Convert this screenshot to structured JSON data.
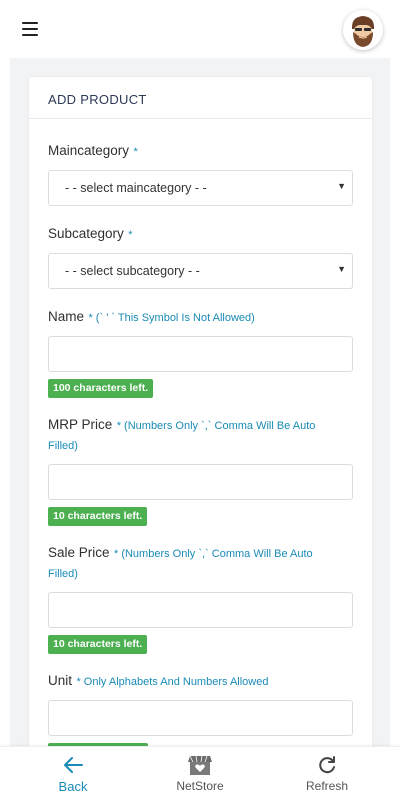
{
  "form": {
    "title": "ADD PRODUCT",
    "maincategory": {
      "label": "Maincategory",
      "required": "*",
      "selected": "- - select maincategory - -"
    },
    "subcategory": {
      "label": "Subcategory",
      "required": "*",
      "selected": "- - select subcategory - -"
    },
    "name": {
      "label": "Name",
      "hint": "* (` ' ` This Symbol Is Not Allowed)",
      "value": "",
      "counter": "100 characters left."
    },
    "mrp_price": {
      "label": "MRP Price",
      "hint_line1": "* (Numbers Only `,` Comma Will Be Auto",
      "hint_line2": "Filled)",
      "value": "",
      "counter": "10 characters left."
    },
    "sale_price": {
      "label": "Sale Price",
      "hint_line1": "* (Numbers Only `,` Comma Will Be Auto",
      "hint_line2": "Filled)",
      "value": "",
      "counter": "10 characters left."
    },
    "unit": {
      "label": "Unit",
      "hint": "* Only Alphabets And Numbers Allowed",
      "value": ""
    }
  },
  "bottom_nav": {
    "back": "Back",
    "netstore": "NetStore",
    "refresh": "Refresh"
  },
  "icons": {
    "menu": "hamburger-menu-icon",
    "avatar": "bearded-man-avatar",
    "back": "arrow-left-icon",
    "netstore": "store-heart-icon",
    "refresh": "refresh-icon"
  },
  "colors": {
    "accent": "#1a8bb5",
    "badge": "#4caf50",
    "background": "#f2f3f5",
    "heading": "#2d3a57"
  }
}
